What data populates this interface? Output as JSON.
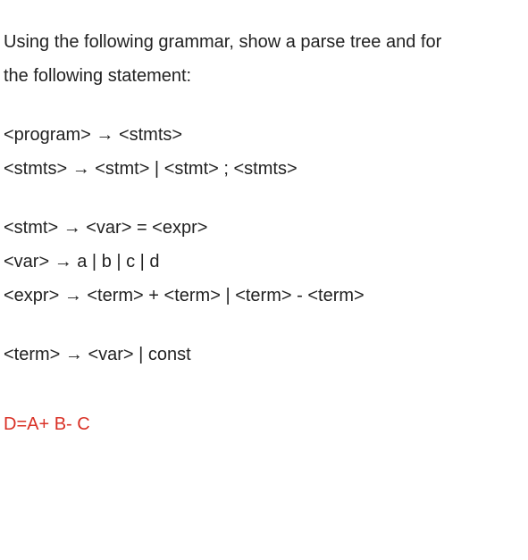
{
  "intro": {
    "line1": "Using the following grammar, show a parse tree and for",
    "line2": "the following statement:"
  },
  "grammar": {
    "block1": {
      "rule1": "<program> → <stmts>",
      "rule2": "<stmts> → <stmt> | <stmt> ; <stmts>"
    },
    "block2": {
      "rule1": "<stmt> → <var> = <expr>",
      "rule2": "<var> → a | b | c | d",
      "rule3": "<expr> → <term> + <term> | <term> - <term>"
    },
    "block3": {
      "rule1": "<term> → <var> | const"
    }
  },
  "statement": "D=A+ B- C"
}
